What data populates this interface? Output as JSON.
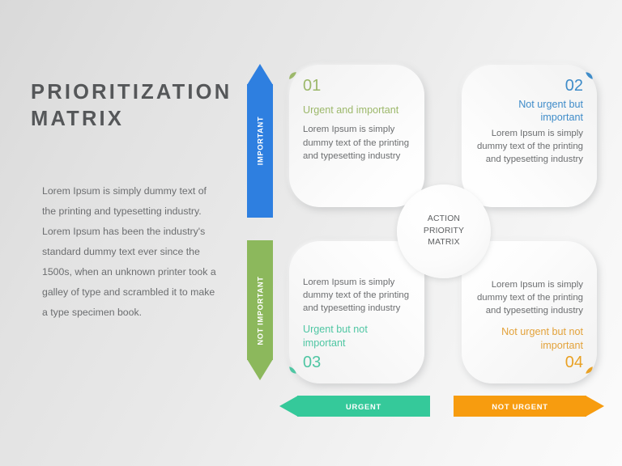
{
  "slide": {
    "title_line1": "PRIORITIZATION",
    "title_line2": "MATRIX",
    "intro_paragraph": "Lorem Ipsum is simply dummy text of the printing and typesetting industry. Lorem Ipsum has been the industry's standard dummy text ever since the 1500s, when an unknown printer took a galley of type and scrambled it to make a type specimen book.",
    "center_label": "ACTION PRIORITY MATRIX"
  },
  "axes": {
    "vertical_up": {
      "label": "IMPORTANT",
      "color": "#2e7fe0",
      "icon": "arrow-up-icon"
    },
    "vertical_down": {
      "label": "NOT IMPORTANT",
      "color": "#8cb85c",
      "icon": "arrow-down-icon"
    },
    "horizontal_left": {
      "label": "URGENT",
      "color": "#35c99a",
      "icon": "arrow-left-icon"
    },
    "horizontal_right": {
      "label": "NOT URGENT",
      "color": "#f79c0f",
      "icon": "arrow-right-icon"
    }
  },
  "quadrants": [
    {
      "number": "01",
      "heading": "Urgent and important",
      "body": "Lorem Ipsum is simply dummy text of the printing and typesetting industry",
      "color": "#9cb86a",
      "leaf_icon": "leaf-accent-icon"
    },
    {
      "number": "02",
      "heading": "Not urgent but important",
      "body": "Lorem Ipsum is simply dummy text of the printing and typesetting industry",
      "color": "#3f8cc9",
      "leaf_icon": "leaf-accent-icon"
    },
    {
      "number": "03",
      "heading": "Urgent but not important",
      "body": "Lorem Ipsum is simply dummy text of the printing and typesetting industry",
      "color": "#4fc6a3",
      "leaf_icon": "leaf-accent-icon"
    },
    {
      "number": "04",
      "heading": "Not urgent but not important",
      "body": "Lorem Ipsum is simply dummy text of the printing and typesetting industry",
      "color": "#e9a124",
      "leaf_icon": "leaf-accent-icon"
    }
  ]
}
